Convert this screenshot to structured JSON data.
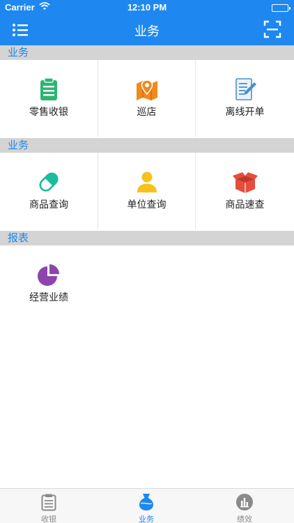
{
  "status_bar": {
    "carrier": "Carrier",
    "time": "12:10 PM"
  },
  "nav": {
    "title": "业务"
  },
  "sections": [
    {
      "header": "业务",
      "items": [
        {
          "label": "零售收银",
          "icon": "clipboard-icon",
          "color": "#2bb673"
        },
        {
          "label": "巡店",
          "icon": "map-pin-icon",
          "color": "#f08a1c"
        },
        {
          "label": "离线开单",
          "icon": "edit-document-icon",
          "color": "#4a90c8"
        }
      ]
    },
    {
      "header": "业务",
      "items": [
        {
          "label": "商品查询",
          "icon": "pill-icon",
          "color": "#1abc9c"
        },
        {
          "label": "单位查询",
          "icon": "person-icon",
          "color": "#f7c21c"
        },
        {
          "label": "商品速查",
          "icon": "open-box-icon",
          "color": "#e74c3c"
        }
      ]
    },
    {
      "header": "报表",
      "items": [
        {
          "label": "经营业绩",
          "icon": "pie-chart-icon",
          "color": "#8e44ad"
        }
      ]
    }
  ],
  "tabs": [
    {
      "label": "收银",
      "icon": "clipboard-icon",
      "active": false
    },
    {
      "label": "业务",
      "icon": "flask-icon",
      "active": true
    },
    {
      "label": "绩效",
      "icon": "bar-chart-icon",
      "active": false
    }
  ]
}
